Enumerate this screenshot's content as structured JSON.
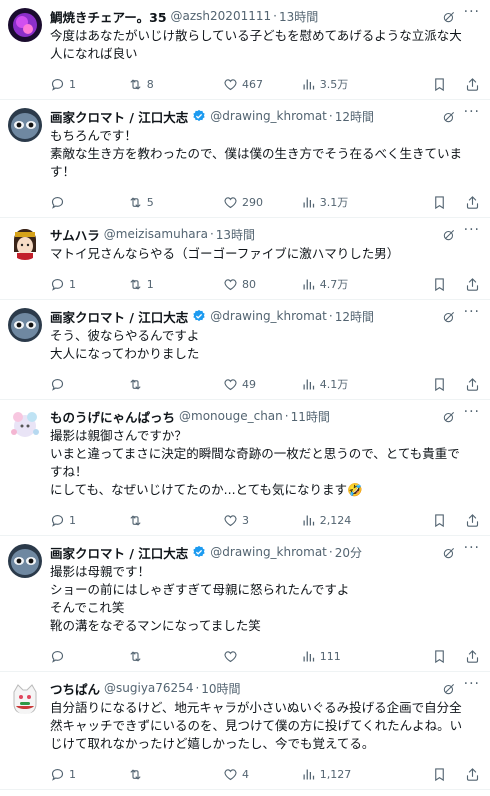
{
  "tweets": [
    {
      "name": "鯛焼きチェアー。35",
      "handle": "@azsh20201111",
      "time": "13時間",
      "verified": false,
      "avatar": "avatar-purple-blob",
      "lines": [
        "今度はあなたがいじけ散らしている子どもを慰めてあげるような立派な大人になれば良い"
      ],
      "replies": "1",
      "retweets": "8",
      "likes": "467",
      "views": "3.5万"
    },
    {
      "name": "画家クロマト / 江口大志",
      "handle": "@drawing_khromat",
      "time": "12時間",
      "verified": true,
      "avatar": "avatar-dark-face",
      "lines": [
        "もちろんです！",
        "素敵な生き方を教わったので、僕は僕の生き方でそう在るべく生きています！"
      ],
      "replies": "",
      "retweets": "5",
      "likes": "290",
      "views": "3.1万"
    },
    {
      "name": "サムハラ",
      "handle": "@meizisamuhara",
      "time": "13時間",
      "verified": false,
      "avatar": "avatar-anime-girl",
      "lines": [
        "マトイ兄さんならやる（ゴーゴーファイブに激ハマりした男）"
      ],
      "replies": "1",
      "retweets": "1",
      "likes": "80",
      "views": "4.7万"
    },
    {
      "name": "画家クロマト / 江口大志",
      "handle": "@drawing_khromat",
      "time": "12時間",
      "verified": true,
      "avatar": "avatar-dark-face",
      "lines": [
        "そう、彼ならやるんですよ",
        "大人になってわかりました"
      ],
      "replies": "",
      "retweets": "",
      "likes": "49",
      "views": "4.1万"
    },
    {
      "name": "ものうげにゃんぱっち",
      "handle": "@monouge_chan",
      "time": "11時間",
      "verified": false,
      "avatar": "avatar-pastel-character",
      "lines": [
        "撮影は親御さんですか？",
        "いまと違ってまさに決定的瞬間な奇跡の一枚だと思うので、とても貴重ですね！",
        "にしても、なぜいじけてたのか...とても気になります🤣"
      ],
      "replies": "1",
      "retweets": "",
      "likes": "3",
      "views": "2,124"
    },
    {
      "name": "画家クロマト / 江口大志",
      "handle": "@drawing_khromat",
      "time": "20分",
      "verified": true,
      "avatar": "avatar-dark-face",
      "lines": [
        "撮影は母親です！",
        "ショーの前にはしゃぎすぎて母親に怒られたんですよ",
        "そんでこれ笑",
        "靴の溝をなぞるマンになってました笑"
      ],
      "replies": "",
      "retweets": "",
      "likes": "",
      "views": "111"
    },
    {
      "name": "つちぱん",
      "handle": "@sugiya76254",
      "time": "10時間",
      "verified": false,
      "avatar": "avatar-cat-character",
      "lines": [
        "自分語りになるけど、地元キャラが小さいぬいぐるみ投げる企画で自分全然キャッチできずにいるのを、見つけて僕の方に投げてくれたんよね。いじけて取れなかったけど嬉しかったし、今でも覚えてる。"
      ],
      "replies": "1",
      "retweets": "",
      "likes": "4",
      "views": "1,127"
    }
  ],
  "colors": {
    "text": "#0f1419",
    "muted": "#536471",
    "verified": "#1d9bf0",
    "divider": "#eff3f4"
  },
  "icons": [
    "reply-icon",
    "retweet-icon",
    "like-icon",
    "views-icon",
    "bookmark-icon",
    "share-icon",
    "grok-icon",
    "more-icon",
    "verified-icon"
  ]
}
